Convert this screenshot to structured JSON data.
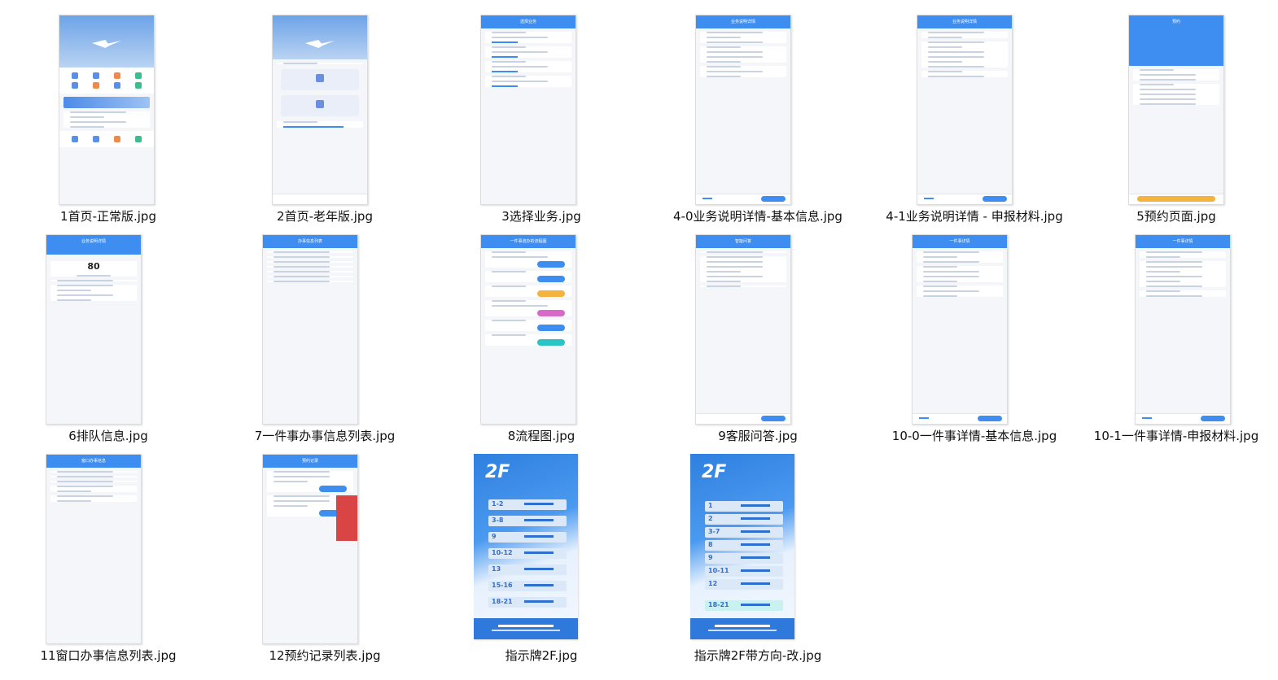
{
  "files": [
    {
      "caption": "1首页-正常版.jpg"
    },
    {
      "caption": "2首页-老年版.jpg"
    },
    {
      "caption": "3选择业务.jpg"
    },
    {
      "caption": "4-0业务说明详情-基本信息.jpg"
    },
    {
      "caption": "4-1业务说明详情 - 申报材料.jpg"
    },
    {
      "caption": "5预约页面.jpg"
    },
    {
      "caption": "6排队信息.jpg"
    },
    {
      "caption": "7一件事办事信息列表.jpg"
    },
    {
      "caption": "8流程图.jpg"
    },
    {
      "caption": "9客服问答.jpg"
    },
    {
      "caption": "10-0一件事详情-基本信息.jpg"
    },
    {
      "caption": "10-1一件事详情-申报材料.jpg"
    },
    {
      "caption": "11窗口办事信息列表.jpg"
    },
    {
      "caption": "12预约记录列表.jpg"
    },
    {
      "caption": "指示牌2F.jpg"
    },
    {
      "caption": "指示牌2F带方向-改.jpg"
    }
  ],
  "thumb_text": {
    "choose_business": "选择业务",
    "business_detail": "业务说明详情",
    "booking": "预约",
    "queue": "业务说明详情",
    "queue_number": "80",
    "list": "办事信息列表",
    "flow": "一件事流办的流程图",
    "service": "智能问答",
    "one_thing": "一件事详情",
    "window_list": "窗口办事信息",
    "booking_records": "预约记录"
  },
  "sign": {
    "floor": "2F",
    "rows": [
      "1-2",
      "3-8",
      "9",
      "10-12",
      "13",
      "15-16",
      "18-21"
    ],
    "rows_dir": [
      "1",
      "2",
      "3-7",
      "8",
      "9",
      "10-11",
      "12",
      "18-21"
    ]
  }
}
